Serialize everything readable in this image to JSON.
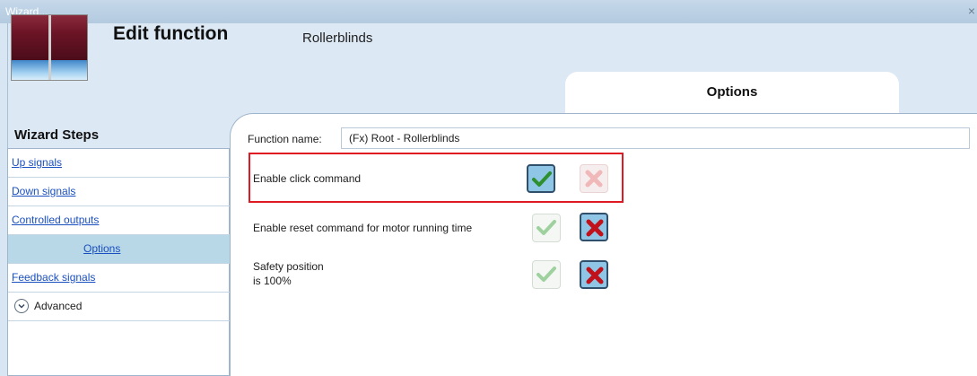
{
  "window": {
    "title": "Wizard...",
    "close_glyph": "×"
  },
  "header": {
    "title": "Edit function",
    "subtitle": "Rollerblinds",
    "icon": "rollerblinds-icon"
  },
  "tab": {
    "label": "Options"
  },
  "wizard": {
    "title": "Wizard Steps",
    "steps": [
      {
        "label": "Up signals",
        "active": false
      },
      {
        "label": "Down signals",
        "active": false
      },
      {
        "label": "Controlled outputs",
        "active": false
      },
      {
        "label": "Options",
        "active": true
      },
      {
        "label": "Feedback signals",
        "active": false
      }
    ],
    "advanced_label": "Advanced"
  },
  "form": {
    "function_name_label": "Function name:",
    "function_name_value": "(Fx) Root - Rollerblinds",
    "options": [
      {
        "label": "Enable click command",
        "value": true
      },
      {
        "label": "Enable reset command for motor running time",
        "value": false
      },
      {
        "label_line1": "Safety position",
        "label_line2": "is 100%",
        "value": false
      }
    ]
  },
  "colors": {
    "highlight": "#e01a22",
    "selected_bg": "#8fc6e6",
    "link": "#1a4fbf"
  }
}
